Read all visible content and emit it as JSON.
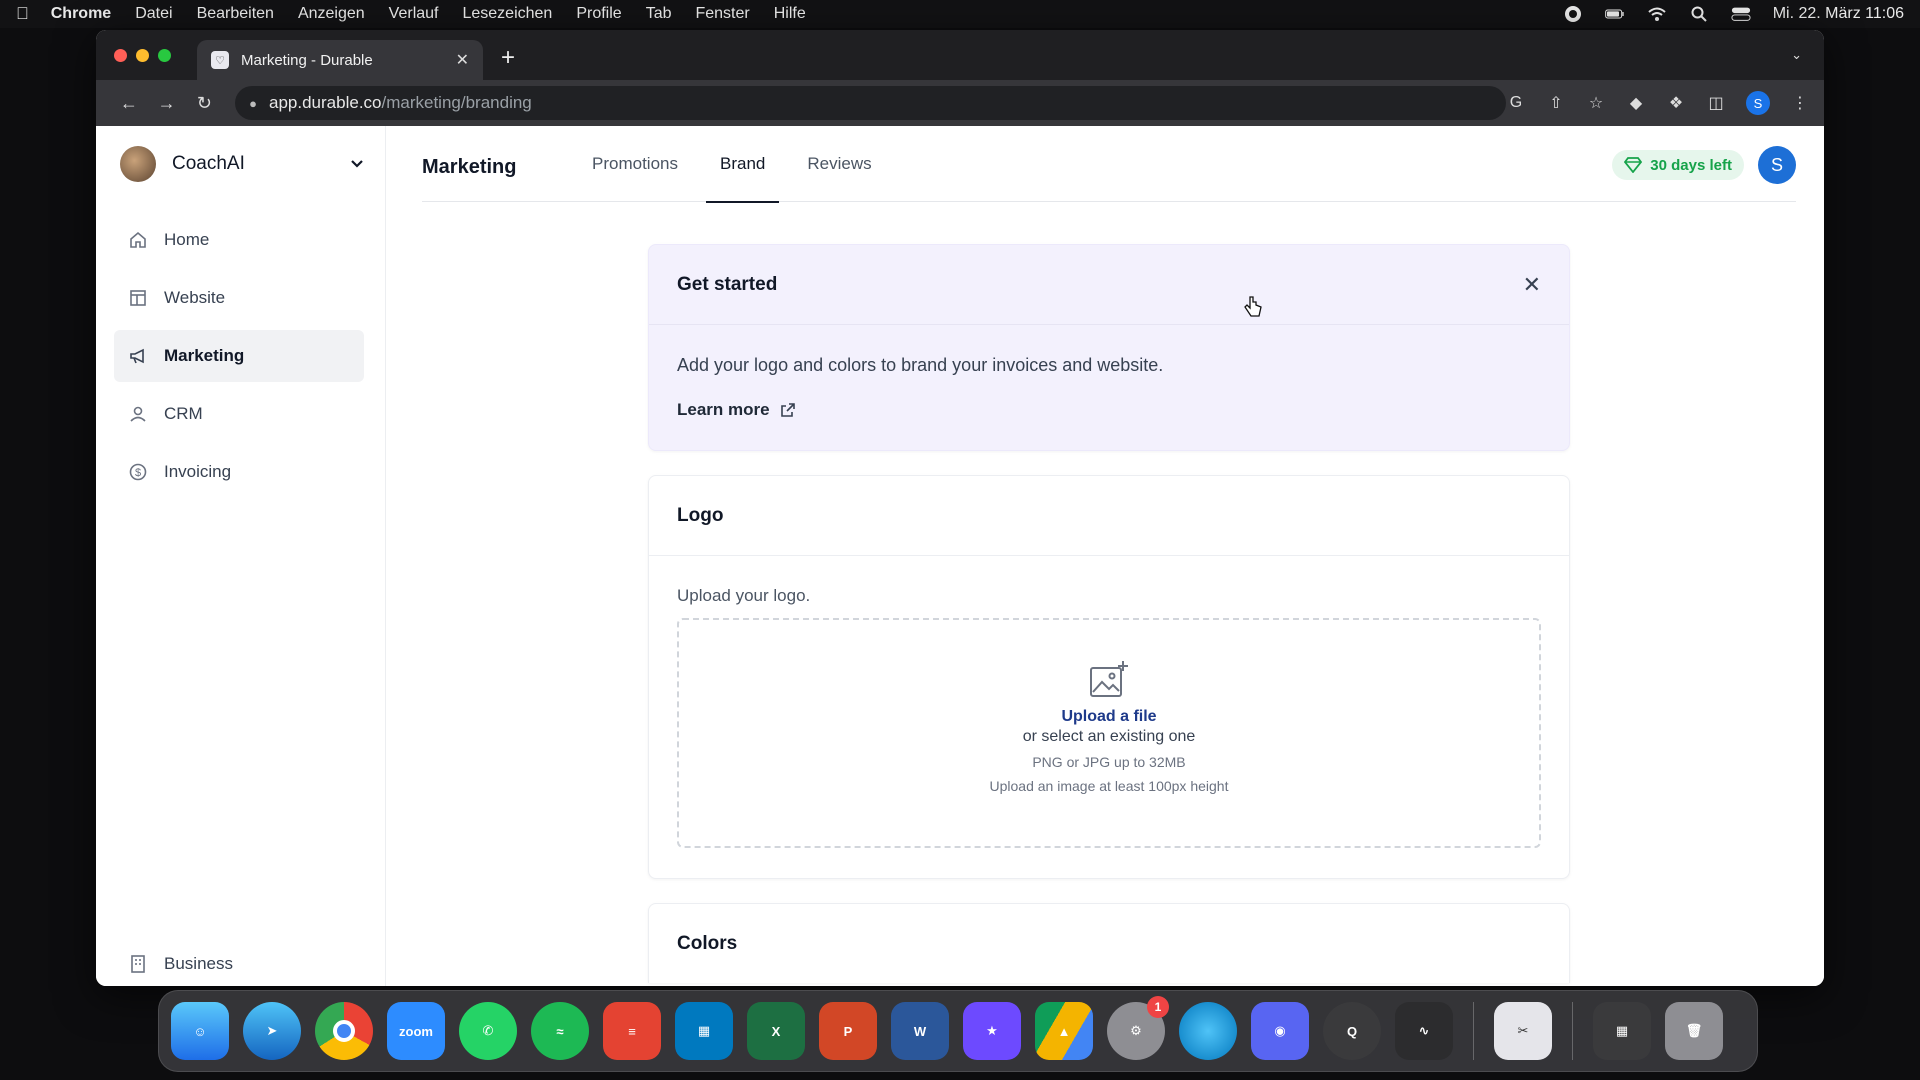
{
  "menubar": {
    "app": "Chrome",
    "items": [
      "Datei",
      "Bearbeiten",
      "Anzeigen",
      "Verlauf",
      "Lesezeichen",
      "Profile",
      "Tab",
      "Fenster",
      "Hilfe"
    ],
    "datetime": "Mi. 22. März 11:06"
  },
  "browser": {
    "tab_title": "Marketing - Durable",
    "url_host": "app.durable.co",
    "url_path": "/marketing/branding",
    "profile_initial": "S"
  },
  "sidebar": {
    "workspace_name": "CoachAI",
    "items": [
      {
        "label": "Home",
        "icon": "home-icon"
      },
      {
        "label": "Website",
        "icon": "website-icon"
      },
      {
        "label": "Marketing",
        "icon": "megaphone-icon",
        "active": true
      },
      {
        "label": "CRM",
        "icon": "contacts-icon"
      },
      {
        "label": "Invoicing",
        "icon": "dollar-icon"
      }
    ],
    "bottom_item": {
      "label": "Business",
      "icon": "building-icon"
    }
  },
  "topnav": {
    "section": "Marketing",
    "tabs": [
      {
        "label": "Promotions",
        "active": false
      },
      {
        "label": "Brand",
        "active": true
      },
      {
        "label": "Reviews",
        "active": false
      }
    ],
    "trial_label": "30 days left",
    "user_initial": "S"
  },
  "get_started": {
    "title": "Get started",
    "text": "Add your logo and colors to brand your invoices and website.",
    "link": "Learn more"
  },
  "logo_card": {
    "title": "Logo",
    "label": "Upload your logo.",
    "upload_link": "Upload a file",
    "upload_sub": "or select an existing one",
    "hint_format": "PNG or JPG up to 32MB",
    "hint_size": "Upload an image at least 100px height"
  },
  "colors_card": {
    "title": "Colors"
  },
  "dock": {
    "apps": [
      "Finder",
      "Safari",
      "Chrome",
      "zoom",
      "WhatsApp",
      "Spotify",
      "Todoist",
      "Trello",
      "Excel",
      "PowerPoint",
      "Word",
      "iMovie",
      "Drive",
      "Settings",
      "Browser",
      "Discord",
      "QuickTime",
      "Audio",
      "Preview",
      "Apps",
      "Trash"
    ],
    "settings_badge": "1"
  },
  "colors": {
    "accent_blue": "#1d6fd6",
    "trial_green": "#16a34a",
    "get_started_bg": "#f3f1fd"
  }
}
